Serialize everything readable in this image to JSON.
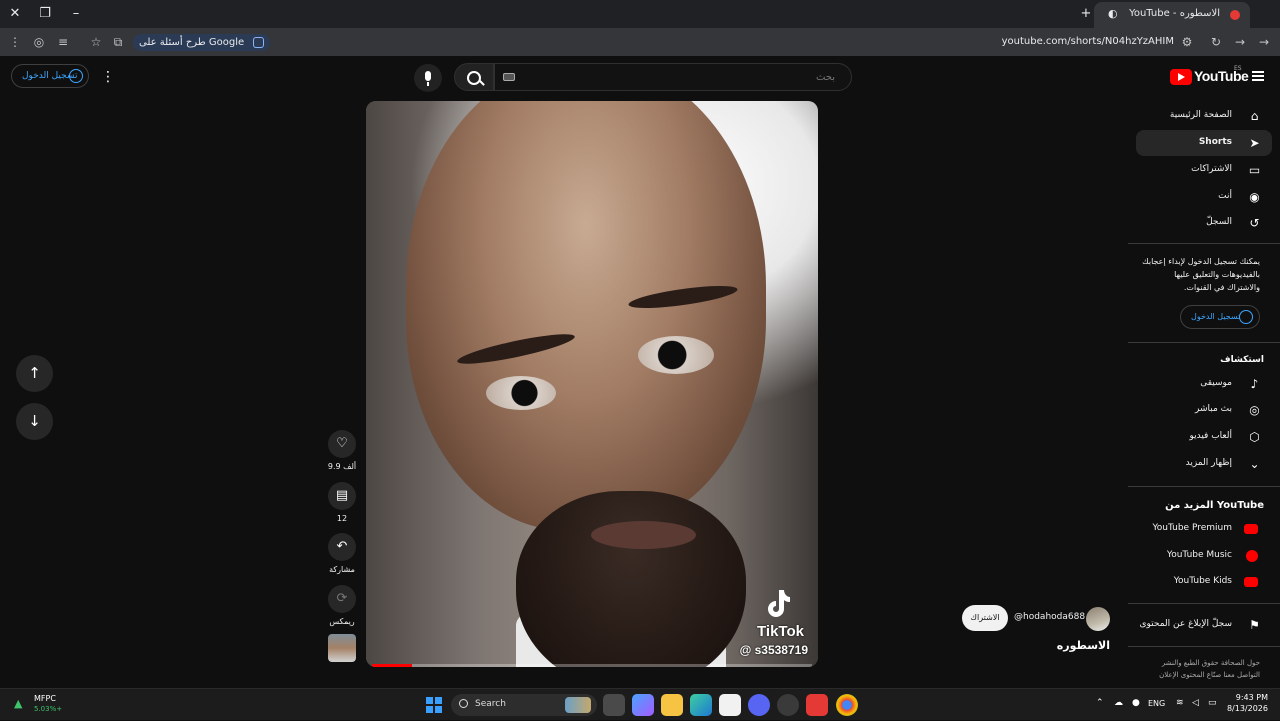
{
  "browser": {
    "tab_title": "الاسطوره - YouTube",
    "url": "youtube.com/shorts/N04hzYzAHIM",
    "ask_google_label": "طرح أسئلة على Google"
  },
  "youtube": {
    "logo_text": "YouTube",
    "logo_region": "ES",
    "search_placeholder": "بحث",
    "sign_in_label": "تسجيل الدخول"
  },
  "guide": {
    "items": [
      {
        "label": "الصفحة الرئيسية",
        "icon": "home-icon"
      },
      {
        "label": "Shorts",
        "icon": "shorts-icon"
      },
      {
        "label": "الاشتراكات",
        "icon": "subscriptions-icon"
      },
      {
        "label": "أنت",
        "icon": "you-icon"
      },
      {
        "label": "السجلّ",
        "icon": "history-icon"
      }
    ],
    "signin_prompt": "يمكنك تسجيل الدخول لإبداء إعجابك بالفيديوهات والتعليق عليها والاشتراك في القنوات.",
    "signin_label": "تسجيل الدخول",
    "explore_heading": "استكشاف",
    "explore": [
      {
        "label": "موسيقى",
        "icon": "music-icon"
      },
      {
        "label": "بث مباشر",
        "icon": "live-icon"
      },
      {
        "label": "ألعاب فيديو",
        "icon": "gaming-icon"
      },
      {
        "label": "إظهار المزيد",
        "icon": "chevron-down-icon"
      }
    ],
    "more_heading": "المزيد من YouTube",
    "more": [
      {
        "label": "YouTube Premium",
        "color": "#ff0000"
      },
      {
        "label": "YouTube Music",
        "color": "#ff0000"
      },
      {
        "label": "YouTube Kids",
        "color": "#ff0000"
      }
    ],
    "report_history": "سجلّ الإبلاغ عن المحتوى",
    "footer": "حول الصحافة  حقوق الطبع والنشر  التواصل معنا  صنّاع المحتوى  الإعلان"
  },
  "short": {
    "watermark_brand": "TikTok",
    "watermark_handle": "@ s3538719",
    "progress_fraction": 0.09,
    "likes_label": "9.9 ألف",
    "comments_label": "12",
    "share_label": "مشاركة",
    "remix_label": "ريمكس",
    "channel_handle": "@hodahoda688",
    "subscribe_label": "الاشتراك",
    "title": "الاسطوره"
  },
  "taskbar": {
    "stock_name": "MFPC",
    "stock_change": "5.03%+",
    "search_label": "Search",
    "language": "ENG",
    "time": "9:43 PM",
    "date": "8/13/2026"
  },
  "colors": {
    "youtube_red": "#ff0000",
    "link_blue": "#3ea6ff",
    "background": "#0f0f0f"
  }
}
